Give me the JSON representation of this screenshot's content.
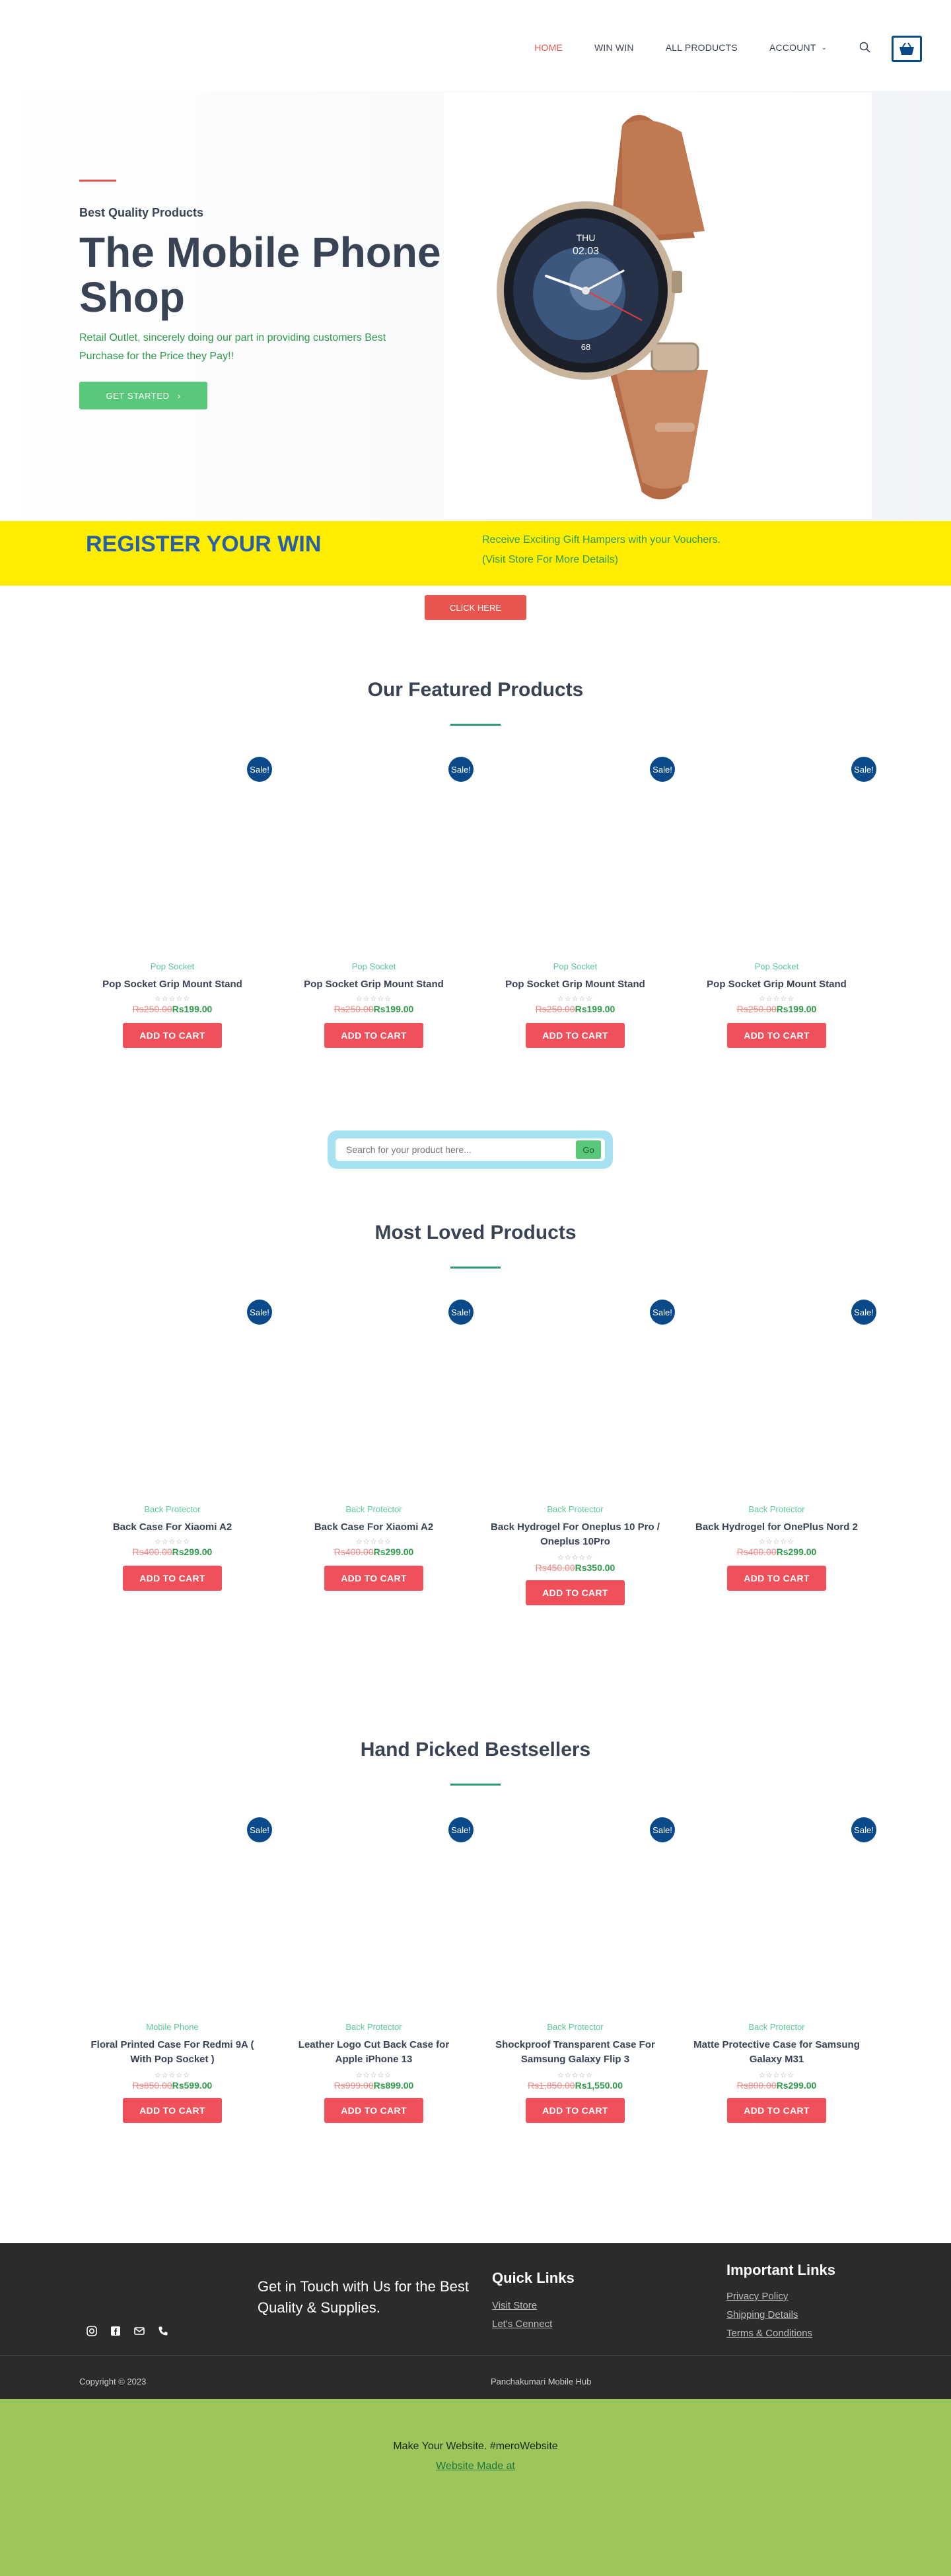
{
  "nav": {
    "items": [
      "HOME",
      "WIN WIN",
      "ALL PRODUCTS",
      "ACCOUNT"
    ],
    "active": "HOME"
  },
  "hero": {
    "kicker": "Best Quality Products",
    "title": "The Mobile Phone Shop",
    "text": "Retail Outlet, sincerely doing our part in providing customers Best Purchase for the Price they Pay!!",
    "button": "GET STARTED",
    "watch": {
      "day": "THU",
      "date": "02.03",
      "heart": "68"
    }
  },
  "register": {
    "title": "REGISTER YOUR WIN",
    "line1": "Receive Exciting Gift Hampers with your Vouchers.",
    "line2": "(Visit Store For More Details)",
    "button": "CLICK HERE"
  },
  "featured": {
    "title": "Our Featured Products",
    "products": [
      {
        "sale": "Sale!",
        "category": "Pop Socket",
        "name": "Pop Socket Grip Mount Stand",
        "stars": "☆☆☆☆☆",
        "old_price": "Rs250.00",
        "new_price": "Rs199.00",
        "button": "ADD TO CART"
      },
      {
        "sale": "Sale!",
        "category": "Pop Socket",
        "name": "Pop Socket Grip Mount Stand",
        "stars": "☆☆☆☆☆",
        "old_price": "Rs250.00",
        "new_price": "Rs199.00",
        "button": "ADD TO CART"
      },
      {
        "sale": "Sale!",
        "category": "Pop Socket",
        "name": "Pop Socket Grip Mount Stand",
        "stars": "☆☆☆☆☆",
        "old_price": "Rs250.00",
        "new_price": "Rs199.00",
        "button": "ADD TO CART"
      },
      {
        "sale": "Sale!",
        "category": "Pop Socket",
        "name": "Pop Socket Grip Mount Stand",
        "stars": "☆☆☆☆☆",
        "old_price": "Rs250.00",
        "new_price": "Rs199.00",
        "button": "ADD TO CART"
      }
    ]
  },
  "search": {
    "placeholder": "Search for your product here...",
    "button": "Go"
  },
  "loved": {
    "title": "Most Loved Products",
    "products": [
      {
        "sale": "Sale!",
        "category": "Back Protector",
        "name": "Back Case For Xiaomi A2",
        "stars": "☆☆☆☆☆",
        "old_price": "Rs400.00",
        "new_price": "Rs299.00",
        "button": "ADD TO CART"
      },
      {
        "sale": "Sale!",
        "category": "Back Protector",
        "name": "Back Case For Xiaomi A2",
        "stars": "☆☆☆☆☆",
        "old_price": "Rs400.00",
        "new_price": "Rs299.00",
        "button": "ADD TO CART"
      },
      {
        "sale": "Sale!",
        "category": "Back Protector",
        "name": "Back Hydrogel For Oneplus 10 Pro / Oneplus 10Pro",
        "stars": "☆☆☆☆☆",
        "old_price": "Rs450.00",
        "new_price": "Rs350.00",
        "button": "ADD TO CART"
      },
      {
        "sale": "Sale!",
        "category": "Back Protector",
        "name": "Back Hydrogel for OnePlus Nord 2",
        "stars": "☆☆☆☆☆",
        "old_price": "Rs400.00",
        "new_price": "Rs299.00",
        "button": "ADD TO CART"
      }
    ]
  },
  "bestsellers": {
    "title": "Hand Picked Bestsellers",
    "products": [
      {
        "sale": "Sale!",
        "category": "Mobile Phone",
        "name": "Floral Printed Case For Redmi 9A ( With Pop Socket )",
        "stars": "☆☆☆☆☆",
        "old_price": "Rs850.00",
        "new_price": "Rs599.00",
        "button": "ADD TO CART"
      },
      {
        "sale": "Sale!",
        "category": "Back Protector",
        "name": "Leather Logo Cut Back Case for Apple iPhone 13",
        "stars": "☆☆☆☆☆",
        "old_price": "Rs999.00",
        "new_price": "Rs899.00",
        "button": "ADD TO CART"
      },
      {
        "sale": "Sale!",
        "category": "Back Protector",
        "name": "Shockproof Transparent Case For Samsung Galaxy Flip 3",
        "stars": "☆☆☆☆☆",
        "old_price": "Rs1,850.00",
        "new_price": "Rs1,550.00",
        "button": "ADD TO CART"
      },
      {
        "sale": "Sale!",
        "category": "Back Protector",
        "name": "Matte Protective Case for Samsung Galaxy M31",
        "stars": "☆☆☆☆☆",
        "old_price": "Rs800.00",
        "new_price": "Rs299.00",
        "button": "ADD TO CART"
      }
    ]
  },
  "footer": {
    "touch": "Get in Touch with Us for the Best Quality & Supplies.",
    "quick_title": "Quick Links",
    "quick": [
      "Visit Store",
      "Let's Cennect"
    ],
    "important_title": "Important Links",
    "important": [
      "Privacy Policy",
      "Shipping Details",
      "Terms & Conditions"
    ],
    "copyright": "Copyright © 2023",
    "brand": "Panchakumari Mobile Hub"
  },
  "bottom": {
    "line1": "Make Your Website. #meroWebsite",
    "line2": "Website Made at"
  },
  "colors": {
    "accent": "#e8554e",
    "brand_blue": "#0b4a8a",
    "green": "#5ac87a",
    "yellow": "#ffee00",
    "footer": "#2b2b2b",
    "bottom": "#9ec45c"
  }
}
